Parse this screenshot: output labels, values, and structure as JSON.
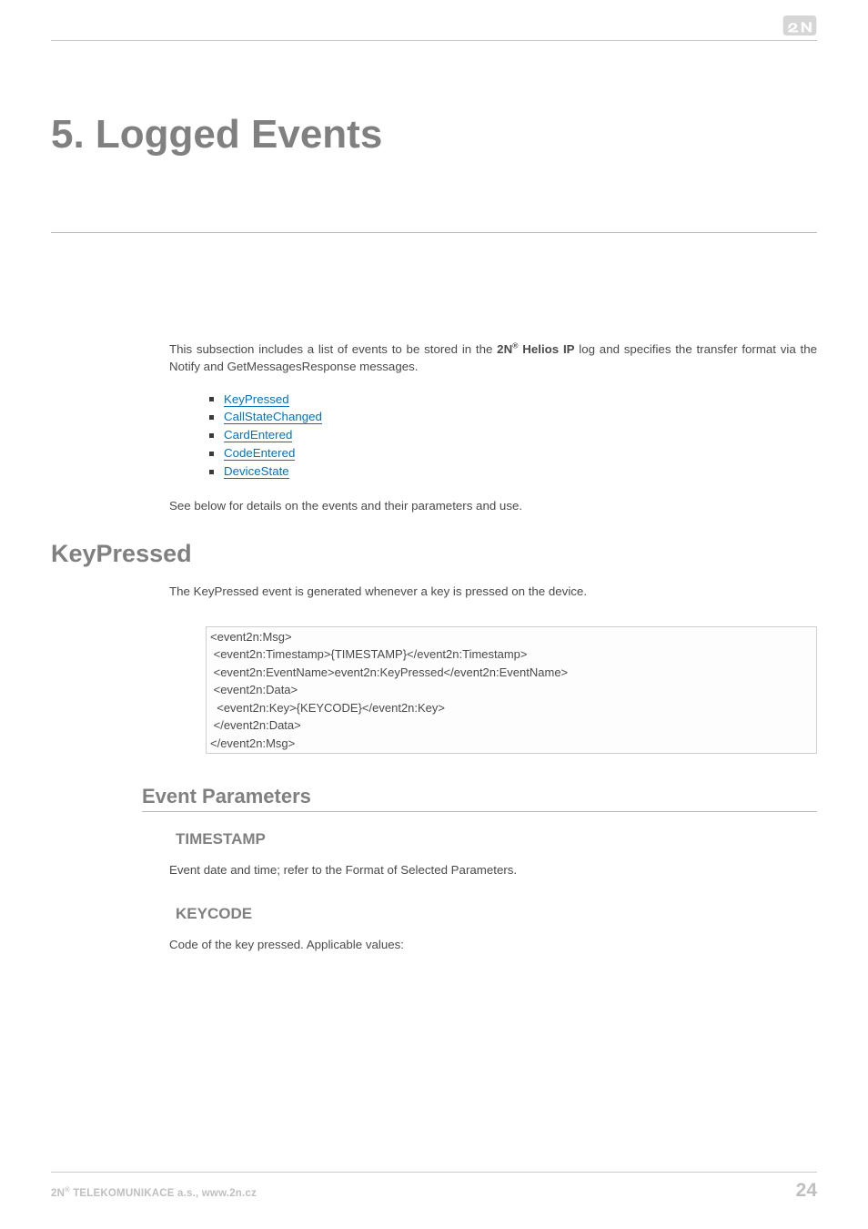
{
  "logo_alt": "2N",
  "page_title": "5. Logged Events",
  "intro_pre": "This subsection includes a list of events to be stored in the ",
  "intro_bold_pre": "2N",
  "intro_bold_post": " Helios IP",
  "intro_post": " log and specifies the transfer format via the Notify and GetMessagesResponse messages.",
  "links": [
    "KeyPressed",
    "CallStateChanged",
    "CardEntered",
    "CodeEntered",
    "DeviceState"
  ],
  "see_below": "See below for details on the events and their parameters and use.",
  "h2_keypressed": "KeyPressed",
  "keypressed_desc": "The KeyPressed event is generated whenever a key is pressed on the device.",
  "code_block": "<event2n:Msg>\n <event2n:Timestamp>{TIMESTAMP}</event2n:Timestamp>\n <event2n:EventName>event2n:KeyPressed</event2n:EventName>\n <event2n:Data>\n  <event2n:Key>{KEYCODE}</event2n:Key>\n </event2n:Data>\n</event2n:Msg>",
  "h3_event_params": "Event Parameters",
  "h4_timestamp": "TIMESTAMP",
  "timestamp_desc": "Event date and time; refer to the Format of Selected Parameters.",
  "h4_keycode": "KEYCODE",
  "keycode_desc": "Code of the key pressed. Applicable values:",
  "footer_left_pre": "2N",
  "footer_left_post": " TELEKOMUNIKACE a.s., www.2n.cz",
  "footer_page": "24"
}
